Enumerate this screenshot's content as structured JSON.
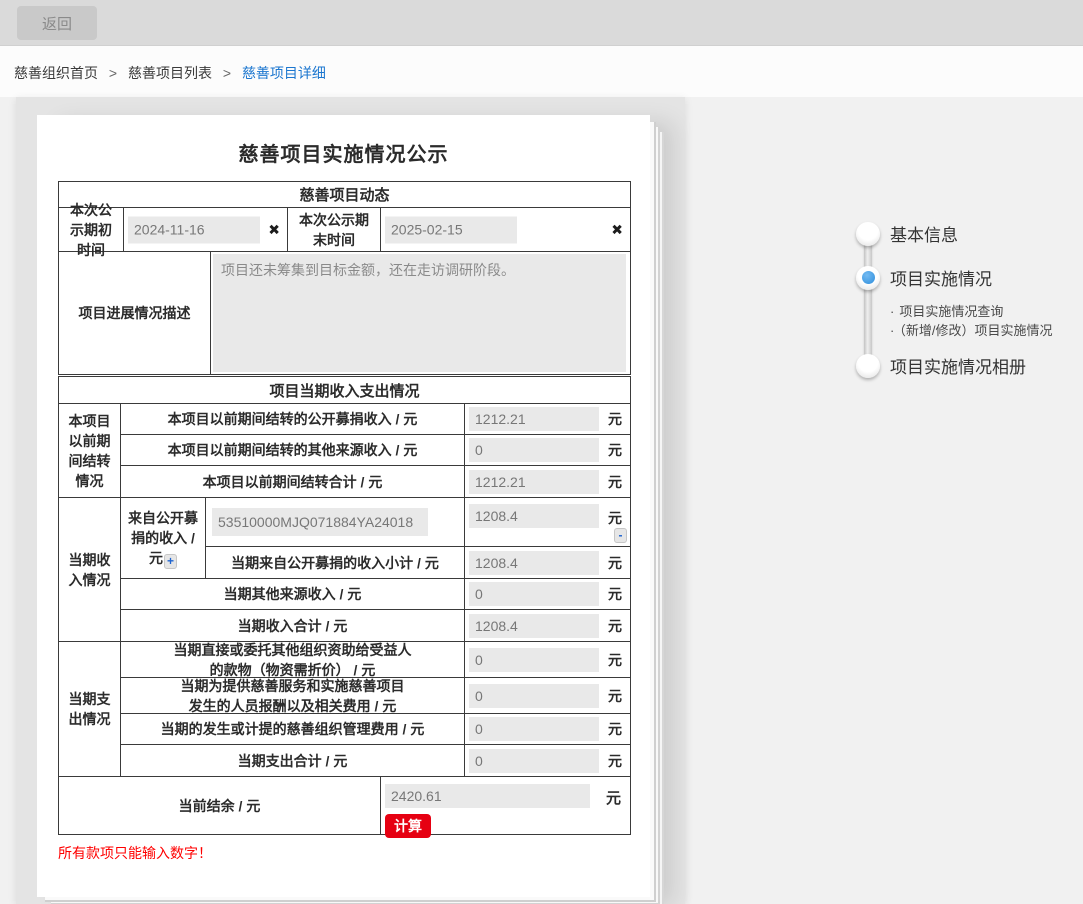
{
  "topbar": {
    "back_label": "返回"
  },
  "breadcrumb": {
    "separator": ">",
    "items": [
      {
        "label": "慈善组织首页"
      },
      {
        "label": "慈善项目列表"
      },
      {
        "label": "慈善项目详细"
      }
    ]
  },
  "colors": {
    "link_blue": "#1b76cf",
    "danger_red": "#e60012",
    "step_blue": "#2e8edc"
  },
  "form": {
    "title": "慈善项目实施情况公示",
    "dynamics": {
      "header": "慈善项目动态",
      "start_label": "本次公示期初时间",
      "start_value": "2024-11-16",
      "end_label": "本次公示期末时间",
      "end_value": "2025-02-15",
      "clear_icon": "✖",
      "desc_label": "项目进展情况描述",
      "desc_value": "项目还未筹集到目标金额，还在走访调研阶段。"
    },
    "finance": {
      "header": "项目当期收入支出情况",
      "carryover": {
        "group_label": "本项目以前期间结转情况",
        "rows": [
          {
            "label": "本项目以前期间结转的公开募捐收入 / 元",
            "value": "1212.21",
            "unit": "元"
          },
          {
            "label": "本项目以前期间结转的其他来源收入 / 元",
            "value": "0",
            "unit": "元"
          },
          {
            "label": "本项目以前期间结转合计 / 元",
            "value": "1212.21",
            "unit": "元"
          }
        ]
      },
      "income": {
        "group_label": "当期收入情况",
        "public_label": "来自公开募捐的收入 / 元",
        "add_label": "+",
        "remove_label": "-",
        "entry": {
          "code": "53510000MJQ071884YA24018",
          "value": "1208.4",
          "unit": "元"
        },
        "subtotal": {
          "label": "当期来自公开募捐的收入小计 / 元",
          "value": "1208.4",
          "unit": "元"
        },
        "other": {
          "label": "当期其他来源收入 / 元",
          "value": "0",
          "unit": "元"
        },
        "total": {
          "label": "当期收入合计 / 元",
          "value": "1208.4",
          "unit": "元"
        }
      },
      "expense": {
        "group_label": "当期支出情况",
        "rows": [
          {
            "label": "当期直接或委托其他组织资助给受益人\n的款物（物资需折价） / 元",
            "value": "0",
            "unit": "元"
          },
          {
            "label": "当期为提供慈善服务和实施慈善项目\n发生的人员报酬以及相关费用 / 元",
            "value": "0",
            "unit": "元"
          },
          {
            "label": "当期的发生或计提的慈善组织管理费用 / 元",
            "value": "0",
            "unit": "元"
          },
          {
            "label": "当期支出合计 / 元",
            "value": "0",
            "unit": "元"
          }
        ]
      },
      "balance": {
        "label": "当前结余 / 元",
        "value": "2420.61",
        "unit": "元",
        "calc_label": "计算"
      },
      "note": "所有款项只能输入数字！"
    }
  },
  "stepper": {
    "items": [
      {
        "label": "基本信息",
        "active": false
      },
      {
        "label": "项目实施情况",
        "active": true
      },
      {
        "label": "项目实施情况相册",
        "active": false
      }
    ],
    "children": [
      {
        "bullet": "·",
        "label": "项目实施情况查询"
      },
      {
        "bullet": "·",
        "label": "（新增/修改）项目实施情况"
      }
    ]
  }
}
